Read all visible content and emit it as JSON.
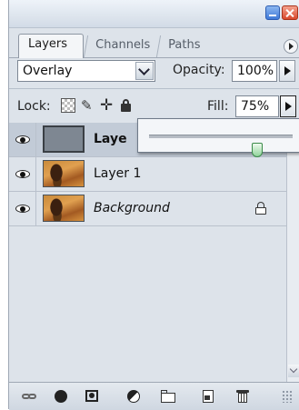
{
  "tabs": [
    {
      "label": "Layers",
      "active": true
    },
    {
      "label": "Channels",
      "active": false
    },
    {
      "label": "Paths",
      "active": false
    }
  ],
  "blend": {
    "mode": "Overlay",
    "opacity_label": "Opacity:",
    "opacity_value": "100%"
  },
  "lock": {
    "label": "Lock:",
    "fill_label": "Fill:",
    "fill_value": "75%"
  },
  "slider": {
    "value_percent": 75
  },
  "layers": [
    {
      "name": "Laye",
      "style": "bold",
      "thumbnail": "solid-gray",
      "visible": true,
      "selected": true
    },
    {
      "name": "Layer 1",
      "style": "normal",
      "thumbnail": "autumn-photo",
      "visible": true,
      "selected": false
    },
    {
      "name": "Background",
      "style": "italic",
      "thumbnail": "autumn-photo",
      "visible": true,
      "selected": false,
      "locked": true
    }
  ],
  "toolbar": [
    "link-icon",
    "fx-icon",
    "mask-icon",
    "adjustment-icon",
    "folder-icon",
    "new-layer-icon",
    "trash-icon"
  ],
  "colors": {
    "panel_bg": "#dde3ea",
    "selected_row": "#c2cbd7",
    "slider_thumb": "#8fd49a"
  }
}
